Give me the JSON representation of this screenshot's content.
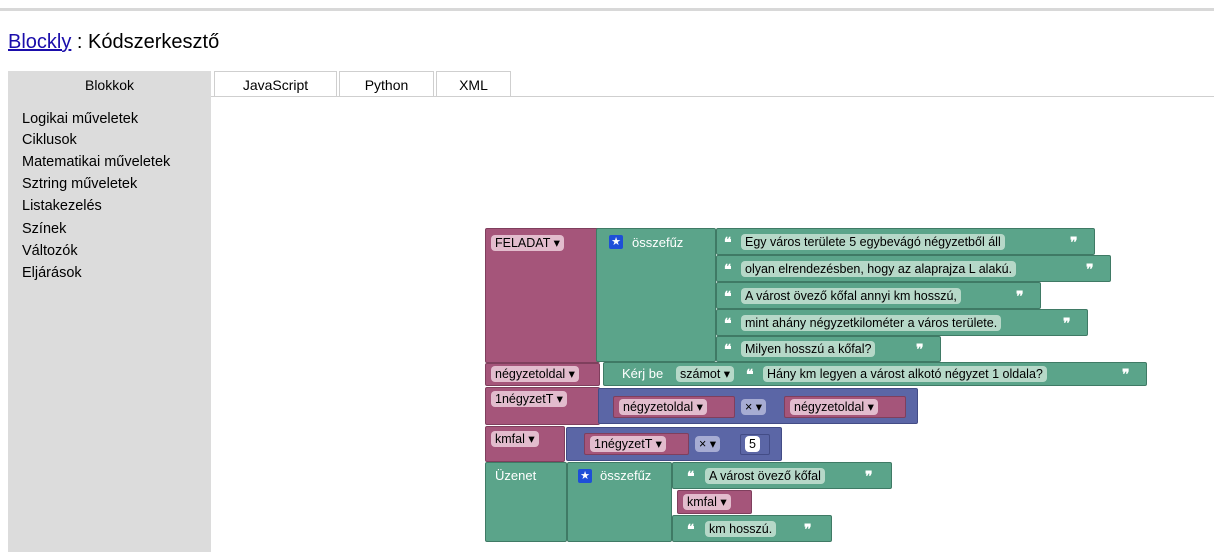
{
  "header": {
    "link": "Blockly",
    "separator": " : ",
    "title": "Kódszerkesztő"
  },
  "tabs": [
    "Blokkok",
    "JavaScript",
    "Python",
    "XML"
  ],
  "toolbox": {
    "items": [
      "Logikai műveletek",
      "Ciklusok",
      "Matematikai műveletek",
      "Sztring műveletek",
      "Listakezelés",
      "Színek",
      "Változók",
      "Eljárások"
    ]
  },
  "blocks": {
    "feladat": {
      "var": "FELADAT ▾",
      "join": "összefűz",
      "texts": [
        "Egy város területe 5 egybevágó négyzetből áll",
        "olyan elrendezésben, hogy az alaprajza L alakú.",
        "A várost övező kőfal annyi km hosszú,",
        "mint ahány négyzetkilométer a város területe.",
        "Milyen hosszú a kőfal?"
      ]
    },
    "negyzetoldal": {
      "var": "négyzetoldal ▾",
      "prompt": "Kérj be",
      "type": "számot ▾",
      "text": "Hány km legyen a várost alkotó négyzet 1 oldala?"
    },
    "negyzetT": {
      "var": "1négyzetT ▾",
      "a": "négyzetoldal ▾",
      "op": "× ▾",
      "b": "négyzetoldal ▾"
    },
    "kmfal": {
      "var": "kmfal ▾",
      "a": "1négyzetT ▾",
      "op": "× ▾",
      "b": "5"
    },
    "uzenet": {
      "label": "Üzenet",
      "join": "összefűz",
      "text1": "A várost övező kőfal",
      "var": "kmfal ▾",
      "text2": "km hosszú."
    },
    "quote_open": "❝",
    "quote_close": "❞",
    "star": "★"
  }
}
